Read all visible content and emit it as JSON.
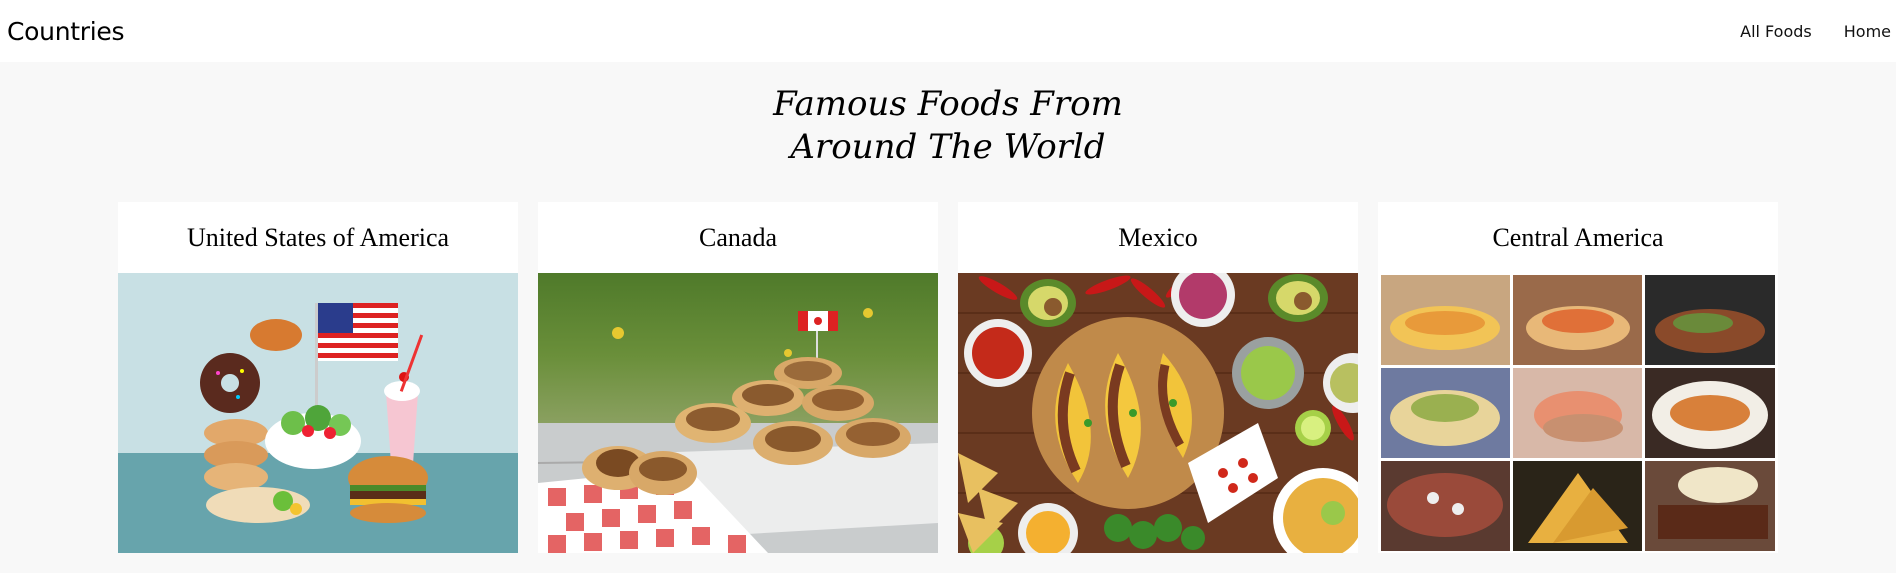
{
  "header": {
    "brand": "Countries",
    "nav": [
      "All Foods",
      "Home"
    ]
  },
  "hero": {
    "title_line1": "Famous Foods From",
    "title_line2": "Around The World"
  },
  "cards": [
    {
      "title": "United States of America",
      "image": "usa-foods-image"
    },
    {
      "title": "Canada",
      "image": "canada-butter-tarts-image"
    },
    {
      "title": "Mexico",
      "image": "mexico-tacos-image"
    },
    {
      "title": "Central America",
      "image": "central-america-collage-image"
    }
  ]
}
